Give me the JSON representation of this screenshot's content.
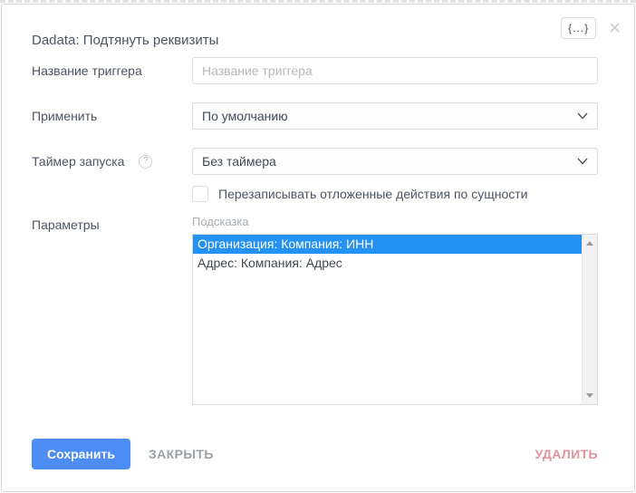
{
  "modal": {
    "title": "Dadata: Подтянуть реквизиты",
    "braces_button_label": "{...}",
    "close_icon": "×"
  },
  "fields": {
    "trigger_name": {
      "label": "Название триггера",
      "placeholder": "Название триггера",
      "value": ""
    },
    "apply": {
      "label": "Применить",
      "value": "По умолчанию"
    },
    "timer": {
      "label": "Таймер запуска",
      "value": "Без таймера",
      "help_icon": "?"
    },
    "overwrite_checkbox": {
      "label": "Перезаписывать отложенные действия по сущности",
      "checked": false
    },
    "parameters": {
      "label": "Параметры",
      "caption": "Подсказка",
      "options": [
        {
          "text": "Организация: Компания: ИНН",
          "selected": true
        },
        {
          "text": "Адрес: Компания: Адрес",
          "selected": false
        }
      ]
    }
  },
  "footer": {
    "save_label": "Сохранить",
    "close_label": "ЗАКРЫТЬ",
    "delete_label": "УДАЛИТЬ"
  },
  "colors": {
    "accent_blue": "#4c8df5",
    "selection_blue": "#2492f4",
    "delete_pink": "#e2929b"
  }
}
